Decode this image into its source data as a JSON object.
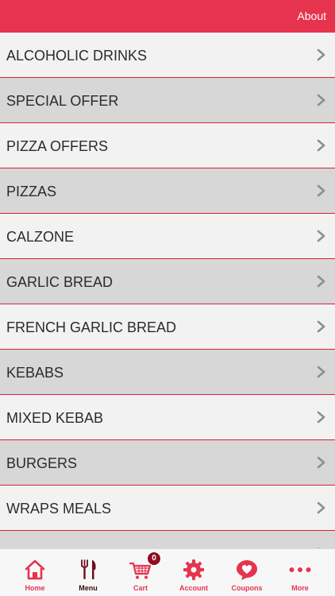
{
  "header": {
    "about_label": "About",
    "bar_color": "#e6344f"
  },
  "menu": {
    "items": [
      {
        "label": "ALCOHOLIC DRINKS",
        "icon": "chevron-right-icon"
      },
      {
        "label": "SPECIAL OFFER",
        "icon": "chevron-right-icon"
      },
      {
        "label": "PIZZA OFFERS",
        "icon": "chevron-right-icon"
      },
      {
        "label": "PIZZAS",
        "icon": "chevron-right-icon"
      },
      {
        "label": "CALZONE",
        "icon": "chevron-right-icon"
      },
      {
        "label": "GARLIC BREAD",
        "icon": "chevron-right-icon"
      },
      {
        "label": "FRENCH GARLIC BREAD",
        "icon": "chevron-right-icon"
      },
      {
        "label": "KEBABS",
        "icon": "chevron-right-icon"
      },
      {
        "label": "MIXED KEBAB",
        "icon": "chevron-right-icon"
      },
      {
        "label": "BURGERS",
        "icon": "chevron-right-icon"
      },
      {
        "label": "WRAPS MEALS",
        "icon": "chevron-right-icon"
      }
    ],
    "row_colors": {
      "light": "#f2f2f2",
      "dark": "#d7d7d7",
      "divider": "#d6203c"
    }
  },
  "tabbar": {
    "tabs": [
      {
        "label": "Home",
        "icon": "home-icon"
      },
      {
        "label": "Menu",
        "icon": "fork-knife-icon",
        "active": true
      },
      {
        "label": "Cart",
        "icon": "cart-icon",
        "badge": "0"
      },
      {
        "label": "Account",
        "icon": "gear-icon"
      },
      {
        "label": "Coupons",
        "icon": "heart-chat-icon"
      },
      {
        "label": "More",
        "icon": "more-dots-icon"
      }
    ],
    "accent_color": "#e6344f",
    "active_color": "#3a0b14"
  }
}
